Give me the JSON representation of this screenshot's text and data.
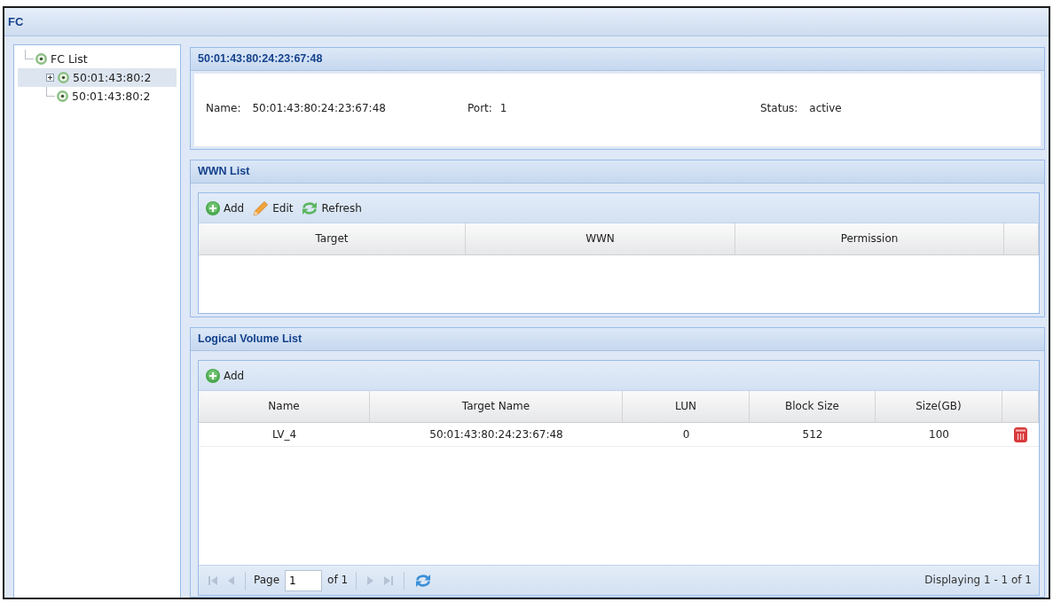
{
  "window": {
    "title": "FC"
  },
  "tree": [
    {
      "label": "FC List",
      "selected": false,
      "children": [
        {
          "label": "50:01:43:80:2",
          "selected": true,
          "expanded": false
        },
        {
          "label": "50:01:43:80:2",
          "selected": false
        }
      ]
    }
  ],
  "detail": {
    "title": "50:01:43:80:24:23:67:48",
    "fields": [
      {
        "label": "Name:",
        "value": "50:01:43:80:24:23:67:48"
      },
      {
        "label": "Port:",
        "value": "1"
      },
      {
        "label": "Status:",
        "value": "active"
      }
    ]
  },
  "wwn_list": {
    "title": "WWN List",
    "toolbar": [
      {
        "kind": "add",
        "label": "Add"
      },
      {
        "kind": "edit",
        "label": "Edit"
      },
      {
        "kind": "refresh",
        "label": "Refresh"
      }
    ],
    "columns": [
      "Target",
      "WWN",
      "Permission"
    ]
  },
  "logical_volume_list": {
    "title": "Logical Volume List",
    "toolbar": [
      {
        "kind": "add",
        "label": "Add"
      }
    ],
    "columns": [
      "Name",
      "Target Name",
      "LUN",
      "Block Size",
      "Size(GB)"
    ],
    "rows": [
      [
        "LV_4",
        "50:01:43:80:24:23:67:48",
        "0",
        "512",
        "100"
      ]
    ],
    "pager": {
      "back_buttons": [
        {
          "kind": "first",
          "disabled": true
        },
        {
          "kind": "prev",
          "disabled": true
        }
      ],
      "page_label": "Page",
      "page": "1",
      "page_count": "of 1",
      "forward_buttons": [
        {
          "kind": "next",
          "disabled": true
        },
        {
          "kind": "last",
          "disabled": true
        }
      ],
      "summary": "Displaying 1 - 1 of 1"
    }
  }
}
